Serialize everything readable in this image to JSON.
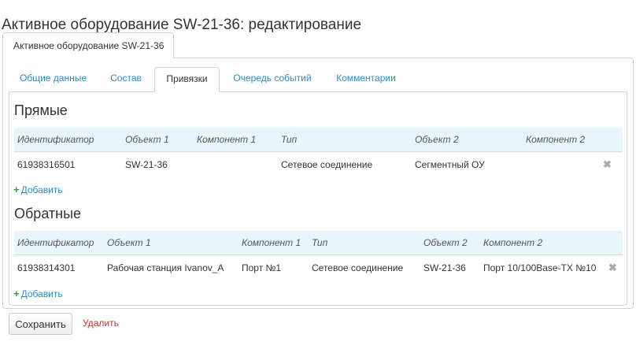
{
  "page_title": "Активное оборудование SW-21-36: редактирование",
  "outer_tab": {
    "label": "Активное оборудование SW-21-36"
  },
  "tabs": [
    {
      "label": "Общие данные"
    },
    {
      "label": "Состав"
    },
    {
      "label": "Привязки",
      "active": true
    },
    {
      "label": "Очередь событий"
    },
    {
      "label": "Комментарии"
    }
  ],
  "direct": {
    "title": "Прямые",
    "columns": [
      "Идентификатор",
      "Объект 1",
      "Компонент 1",
      "Тип",
      "Объект 2",
      "Компонент 2"
    ],
    "rows": [
      {
        "id": "61938316501",
        "object1": "SW-21-36",
        "component1": "",
        "type": "Сетевое соединение",
        "object2": "Сегментный ОУ",
        "component2": ""
      }
    ],
    "add_label": "Добавить"
  },
  "reverse": {
    "title": "Обратные",
    "columns": [
      "Идентификатор",
      "Объект 1",
      "Компонент 1",
      "Тип",
      "Объект 2",
      "Компонент 2"
    ],
    "rows": [
      {
        "id": "61938314301",
        "object1": "Рабочая станция Ivanov_A",
        "component1": "Порт №1",
        "type": "Сетевое соединение",
        "object2": "SW-21-36",
        "component2": "Порт 10/100Base-TX №10"
      }
    ],
    "add_label": "Добавить"
  },
  "icons": {
    "remove": "close-icon",
    "add": "plus-icon"
  },
  "colors": {
    "link": "#2a8bc7",
    "table_header_bg": "#e8f6fb",
    "add_plus": "#3aa03a",
    "danger": "#c9302c"
  },
  "actions": {
    "save_label": "Сохранить",
    "delete_label": "Удалить"
  }
}
